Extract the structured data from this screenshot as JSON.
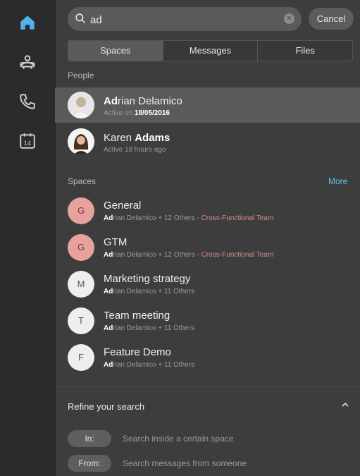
{
  "rail": {
    "items": [
      {
        "name": "home-icon",
        "active": true
      },
      {
        "name": "teams-icon",
        "active": false
      },
      {
        "name": "phone-icon",
        "active": false
      },
      {
        "name": "calendar-icon",
        "label": "14",
        "active": false
      }
    ]
  },
  "search": {
    "value": "ad",
    "cancel_label": "Cancel"
  },
  "tabs": [
    {
      "label": "Spaces",
      "active": true
    },
    {
      "label": "Messages",
      "active": false
    },
    {
      "label": "Files",
      "active": false
    }
  ],
  "people": {
    "heading": "People",
    "items": [
      {
        "name_match": "Ad",
        "name_rest": "rian Delamico",
        "sub_label": "Active on ",
        "sub_value": "18/05/2016"
      },
      {
        "name_pre": "Karen ",
        "name_match": "Adams",
        "sub": "Active 18 hours ago"
      }
    ]
  },
  "spaces": {
    "heading": "Spaces",
    "more_label": "More",
    "items": [
      {
        "letter": "G",
        "title": "General",
        "sub_match": "Ad",
        "sub_rest": "rian Delamico + 12 Others - ",
        "team": "Cross-Functional Team",
        "color": "pink"
      },
      {
        "letter": "G",
        "title": "GTM",
        "sub_match": "Ad",
        "sub_rest": "rian Delamico + 12 Others - ",
        "team": "Cross-Functional Team",
        "color": "pink"
      },
      {
        "letter": "M",
        "title": "Marketing strategy",
        "sub_match": "Ad",
        "sub_rest": "rian Delamico + 11 Others",
        "color": "gray"
      },
      {
        "letter": "T",
        "title": "Team meeting",
        "sub_match": "Ad",
        "sub_rest": "rian Delamico + 11 Others",
        "color": "gray"
      },
      {
        "letter": "F",
        "title": "Feature Demo",
        "sub_match": "Ad",
        "sub_rest": "rian Delamico + 11 Others",
        "color": "gray"
      }
    ]
  },
  "refine": {
    "title": "Refine your search",
    "filters": [
      {
        "label": "In:",
        "hint": "Search inside a certain space"
      },
      {
        "label": "From:",
        "hint": "Search messages from someone"
      }
    ]
  },
  "colors": {
    "accent": "#5fc4e6",
    "home_icon": "#4fb3e8",
    "team_text": "#d98a8a",
    "avatar_pink": "#e8a29e",
    "avatar_gray": "#eeeeee"
  }
}
